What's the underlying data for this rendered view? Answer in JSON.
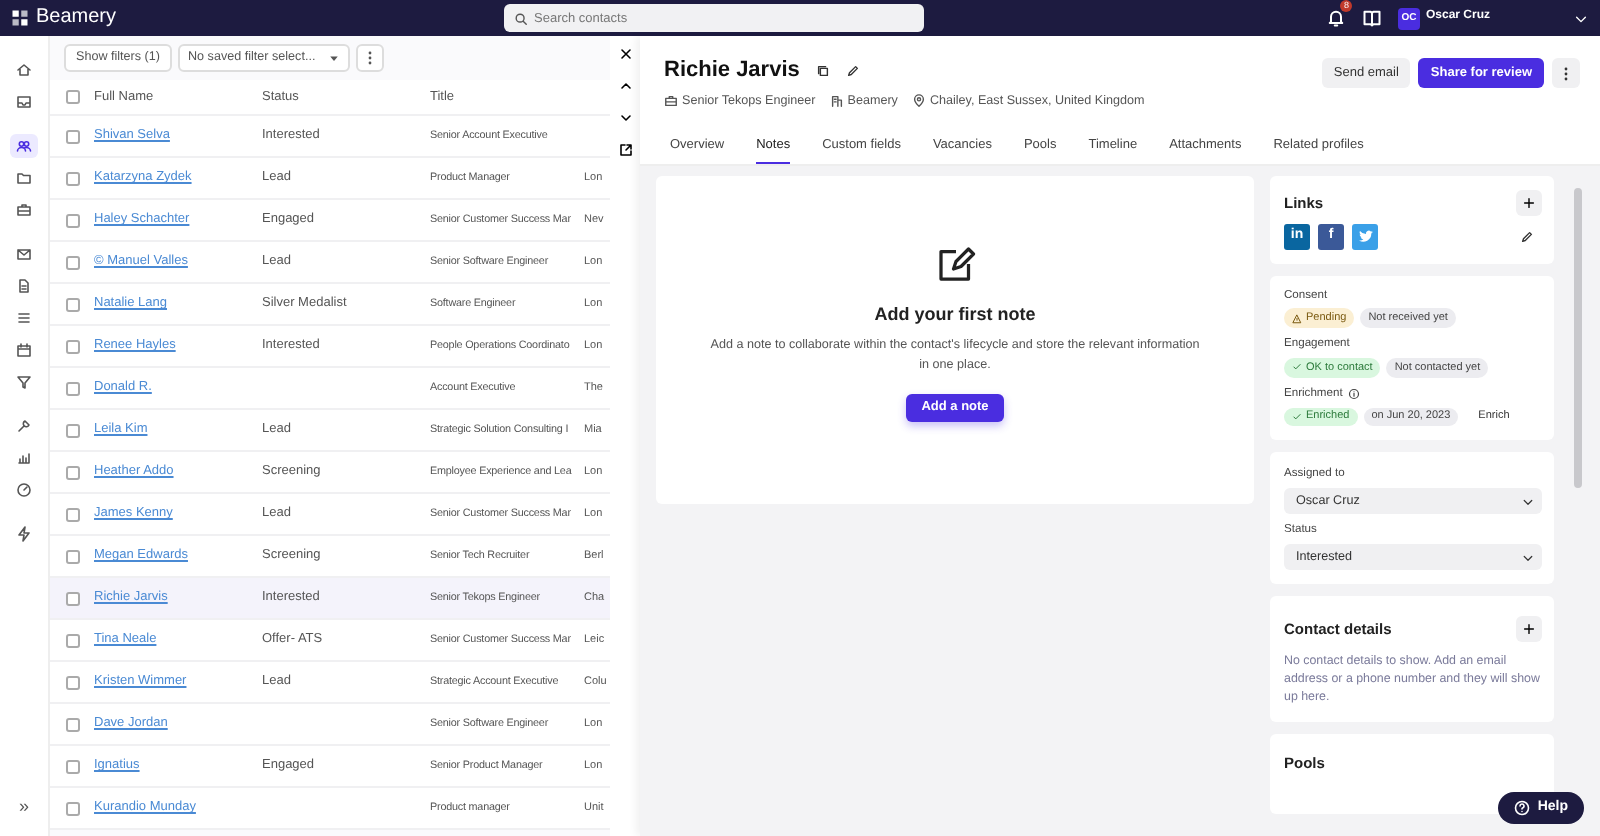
{
  "topbar": {
    "logo": "Beamery",
    "search": {
      "placeholder": "Search contacts"
    },
    "notifications_badge": "8",
    "user": {
      "initials": "OC",
      "name": "Oscar Cruz"
    }
  },
  "sidebar": {
    "groups": [
      {
        "items": [
          {
            "selected": false
          },
          {
            "selected": false
          }
        ]
      },
      {
        "items": [
          {
            "selected": true
          },
          {
            "selected": false
          },
          {
            "selected": false
          }
        ]
      },
      {
        "items": [
          {
            "selected": false
          },
          {
            "selected": false
          },
          {
            "selected": false
          },
          {
            "selected": false
          },
          {
            "selected": false
          }
        ]
      },
      {
        "items": [
          {
            "selected": false
          },
          {
            "selected": false
          },
          {
            "selected": false
          }
        ]
      },
      {
        "items": [
          {
            "selected": false
          }
        ]
      }
    ],
    "expand": "»"
  },
  "list_toolbar": {
    "filter_button": "Show filters (1)",
    "saved_filter": {
      "placeholder": "No saved filter select..."
    }
  },
  "table": {
    "header_checked": false,
    "columns": [
      "Full Name",
      "Status",
      "Title"
    ],
    "rows": [
      {
        "name": "Shivan Selva",
        "status": "Interested",
        "title": "Senior Account Executive",
        "checked": false,
        "selected": false
      },
      {
        "name": "Katarzyna Zydek",
        "status": "Lead",
        "title": "Product Manager",
        "column_4": "Lon",
        "checked": false,
        "selected": false
      },
      {
        "name": "Haley Schachter",
        "status": "Engaged",
        "title": "Senior Customer Success Mar",
        "column_4": "Nev",
        "checked": false,
        "selected": false
      },
      {
        "name": "© Manuel Valles",
        "status": "Lead",
        "title": "Senior Software Engineer",
        "column_4": "Lon",
        "checked": false,
        "selected": false
      },
      {
        "name": "Natalie Lang",
        "status": "Silver Medalist",
        "title": "Software Engineer",
        "column_4": "Lon",
        "checked": false,
        "selected": false
      },
      {
        "name": "Renee Hayles",
        "status": "Interested",
        "title": "People Operations Coordinato",
        "column_4": "Lon",
        "checked": false,
        "selected": false
      },
      {
        "name": "Donald R.",
        "title": "Account Executive",
        "column_4": "The",
        "checked": false,
        "selected": false
      },
      {
        "name": "Leila Kim",
        "status": "Lead",
        "title": "Strategic Solution Consulting I",
        "column_4": "Mia",
        "checked": false,
        "selected": false
      },
      {
        "name": "Heather Addo",
        "status": "Screening",
        "title": "Employee Experience and Lea",
        "column_4": "Lon",
        "checked": false,
        "selected": false
      },
      {
        "name": "James Kenny",
        "status": "Lead",
        "title": "Senior Customer Success Mar",
        "column_4": "Lon",
        "checked": false,
        "selected": false
      },
      {
        "name": "Megan Edwards",
        "status": "Screening",
        "title": "Senior Tech Recruiter",
        "column_4": "Berl",
        "checked": false,
        "selected": false
      },
      {
        "name": "Richie Jarvis",
        "status": "Interested",
        "title": "Senior Tekops Engineer",
        "column_4": "Cha",
        "checked": false,
        "selected": true
      },
      {
        "name": "Tina Neale",
        "status": "Offer- ATS",
        "title": "Senior Customer Success Mar",
        "column_4": "Leic",
        "checked": false,
        "selected": false
      },
      {
        "name": "Kristen Wimmer",
        "status": "Lead",
        "title": "Strategic Account Executive",
        "column_4": "Colu",
        "checked": false,
        "selected": false
      },
      {
        "name": "Dave Jordan",
        "title": "Senior Software Engineer",
        "column_4": "Lon",
        "checked": false,
        "selected": false
      },
      {
        "name": "Ignatius",
        "status": "Engaged",
        "title": "Senior Product Manager",
        "column_4": "Lon",
        "checked": false,
        "selected": false
      },
      {
        "name": "Kurandio Munday",
        "title": "Product manager",
        "column_4": "Unit",
        "checked": false,
        "selected": false
      }
    ]
  },
  "detail": {
    "name": "Richie Jarvis",
    "job_title": "Senior Tekops Engineer",
    "company": "Beamery",
    "location": "Chailey, East Sussex, United Kingdom",
    "buttons": [
      "Send email",
      "Share for review"
    ],
    "tabs": [
      {
        "label": "Overview",
        "selected": false
      },
      {
        "label": "Notes",
        "selected": true
      },
      {
        "label": "Custom fields",
        "selected": false
      },
      {
        "label": "Vacancies",
        "selected": false
      },
      {
        "label": "Pools",
        "selected": false
      },
      {
        "label": "Timeline",
        "selected": false
      },
      {
        "label": "Attachments",
        "selected": false
      },
      {
        "label": "Related profiles",
        "selected": false
      }
    ],
    "notes_empty": {
      "title": "Add your first note",
      "text": "Add a note to collaborate within the contact's lifecycle and store the relevant information in one place.",
      "button": "Add a note"
    },
    "links": {
      "title": "Links",
      "profiles": [
        {
          "kind": "linkedin",
          "label": "in"
        },
        {
          "kind": "facebook",
          "label": "f"
        },
        {
          "kind": "twitter"
        }
      ]
    },
    "consent": [
      {
        "label": "Consent",
        "info": false,
        "chips": [
          {
            "kind": "warning",
            "text": "Pending"
          },
          {
            "kind": "neutral",
            "text": "Not received yet"
          }
        ]
      },
      {
        "label": "Engagement",
        "info": false,
        "chips": [
          {
            "kind": "success",
            "text": "OK to contact"
          },
          {
            "kind": "neutral",
            "text": "Not contacted yet"
          }
        ]
      },
      {
        "label": "Enrichment",
        "info": true,
        "chips": [
          {
            "kind": "success",
            "text": "Enriched"
          },
          {
            "kind": "neutral",
            "text": "on Jun 20, 2023"
          }
        ],
        "action": "Enrich"
      }
    ],
    "assignment": [
      {
        "label": "Assigned to",
        "value": "Oscar Cruz"
      },
      {
        "label": "Status",
        "value": "Interested"
      }
    ],
    "contact_details": {
      "title": "Contact details",
      "text": "No contact details to show. Add an email address or a phone number and they will show up here."
    },
    "pools": {
      "title": "Pools"
    }
  },
  "help_button": "Help"
}
